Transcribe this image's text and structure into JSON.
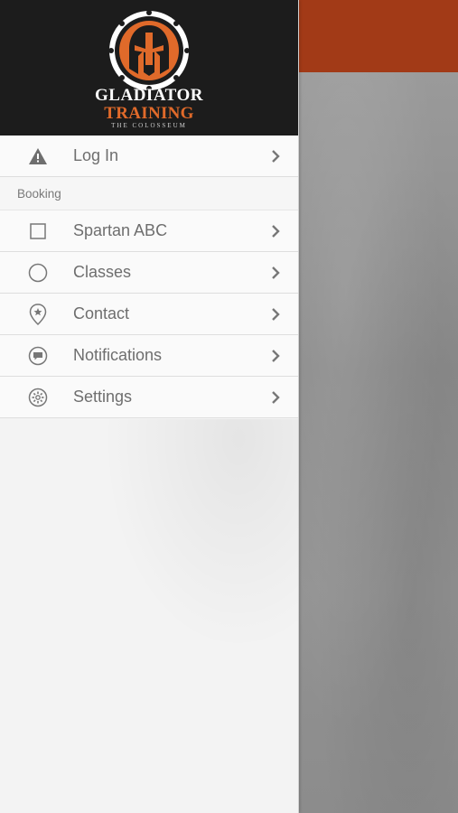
{
  "app": {
    "logo": {
      "line1": "GLADIATOR",
      "line2": "TRAINING",
      "line3": "THE COLOSSEUM"
    }
  },
  "menu": {
    "login": {
      "label": "Log In",
      "icon": "warning-icon"
    },
    "section_label": "Booking",
    "items": [
      {
        "label": "Spartan ABC",
        "icon": "square-icon"
      },
      {
        "label": "Classes",
        "icon": "circle-icon"
      },
      {
        "label": "Contact",
        "icon": "location-pin-icon"
      },
      {
        "label": "Notifications",
        "icon": "chat-bubble-icon"
      },
      {
        "label": "Settings",
        "icon": "gear-icon"
      }
    ]
  },
  "colors": {
    "header_bg": "#1c1c1c",
    "accent_orange": "#e06a2a",
    "app_bar": "#a23a17"
  }
}
